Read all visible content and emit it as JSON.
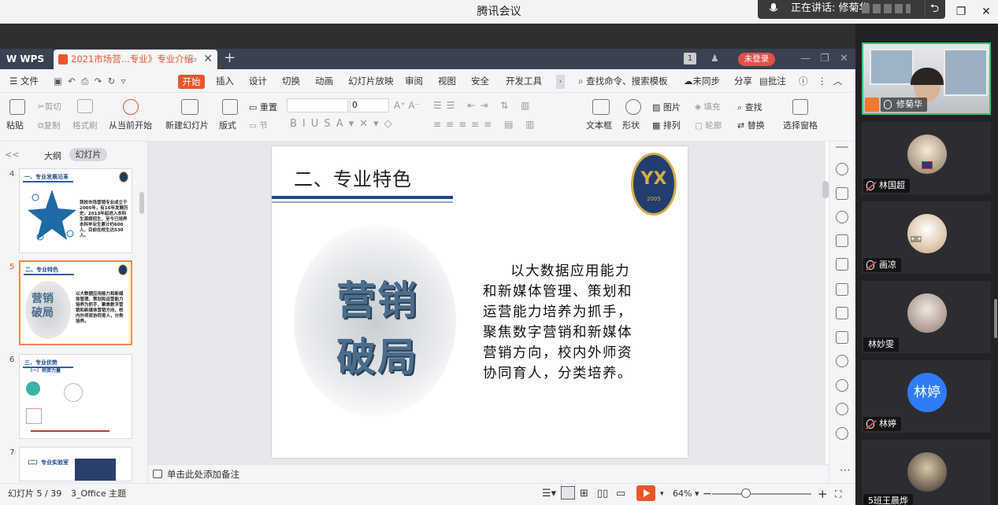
{
  "meeting": {
    "title": "腾讯会议",
    "speaking_label": "正在讲话: 修菊华;"
  },
  "wps": {
    "logo": "WPS",
    "doc_tab": "2021市场营...专业》专业介绍",
    "new_tab": "+",
    "page_indicator": "1",
    "login_btn": "未登录"
  },
  "menu": {
    "file": "文件",
    "items": [
      "开始",
      "插入",
      "设计",
      "切换",
      "动画",
      "幻灯片放映",
      "审阅",
      "视图",
      "安全",
      "开发工具"
    ],
    "search": "查找命令、搜索模板",
    "right": [
      "未同步",
      "分享",
      "批注"
    ]
  },
  "ribbon": {
    "paste": "粘贴",
    "cut": "剪切",
    "copy": "复制",
    "format_painter": "格式刷",
    "from_current": "从当前开始",
    "new_slide": "新建幻灯片",
    "layout": "版式",
    "reset": "重置",
    "section": "节",
    "font_name": "",
    "font_size": "0",
    "textbox": "文本框",
    "shape": "形状",
    "picture": "图片",
    "fill": "填充",
    "arrange": "排列",
    "outline": "轮廓",
    "find": "查找",
    "replace": "替换",
    "select_pane": "选择窗格"
  },
  "left_pane": {
    "tab_outline": "大纲",
    "tab_slides": "幻灯片",
    "collapse": "<<",
    "thumbs": [
      {
        "num": "4",
        "title": "一、专业发展沿革",
        "text": "我校市场营销专业成立于2005年，有16年发展历史。2013年起进入本科生源提招生，至今已培养本科毕业生累计约600人，目前在校生达530人。"
      },
      {
        "num": "5",
        "title": "二、专业特色",
        "text": "以大数据应用能力和新媒体管理、策划和运营能力培养为抓手，聚焦数字营销和新媒体营销方向，校内外师资协同育人，分类培养。"
      },
      {
        "num": "6",
        "title": "三、专业优势",
        "sub": "（一）师资力量"
      },
      {
        "num": "7",
        "title": "（二）专业实验室"
      }
    ]
  },
  "slide": {
    "title": "二、专业特色",
    "badge_text": "YX",
    "badge_year": "2005",
    "image_chars": [
      "营",
      "销",
      "破",
      "局"
    ],
    "body": "以大数据应用能力和新媒体管理、策划和运营能力培养为抓手，聚焦数字营销和新媒体营销方向，校内外师资协同育人，分类培养。"
  },
  "notes": {
    "placeholder": "单击此处添加备注"
  },
  "status": {
    "slide_count": "幻灯片 5 / 39",
    "theme": "3_Office 主题",
    "zoom": "64%",
    "zoom_minus": "−",
    "zoom_plus": "+"
  },
  "participants": [
    {
      "name": "修菊华",
      "speaking": true
    },
    {
      "name": "林国超",
      "speaking": false
    },
    {
      "name": "画凉",
      "speaking": false
    },
    {
      "name": "林妙雯",
      "speaking": false
    },
    {
      "name": "林婷",
      "speaking": false,
      "avatar_text": "林婷",
      "avatar_color": "#2f7cf6"
    },
    {
      "name": "5班王晨烨",
      "speaking": false
    }
  ],
  "colors": {
    "accent": "#e8572a",
    "wps_dark": "#3a4150",
    "slide_navy": "#1e4a8c",
    "speaking_border": "#3ec06a"
  }
}
